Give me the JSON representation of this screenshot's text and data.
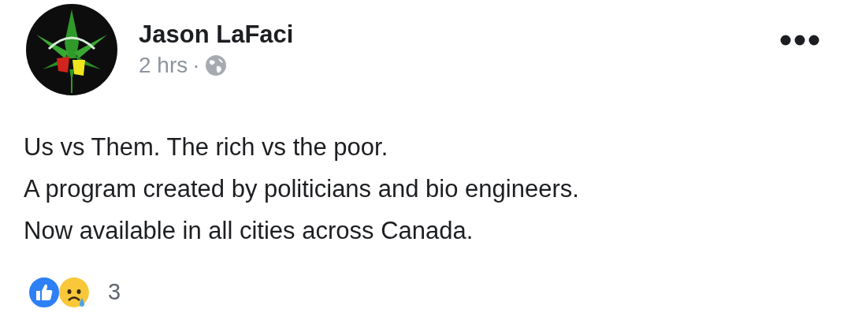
{
  "post": {
    "author": "Jason LaFaci",
    "time": "2 hrs",
    "separator": "·",
    "body": [
      "Us vs Them. The rich vs the poor.",
      "A program created by politicians and bio engineers.",
      "Now available in all cities across Canada."
    ],
    "reaction_count": "3"
  }
}
